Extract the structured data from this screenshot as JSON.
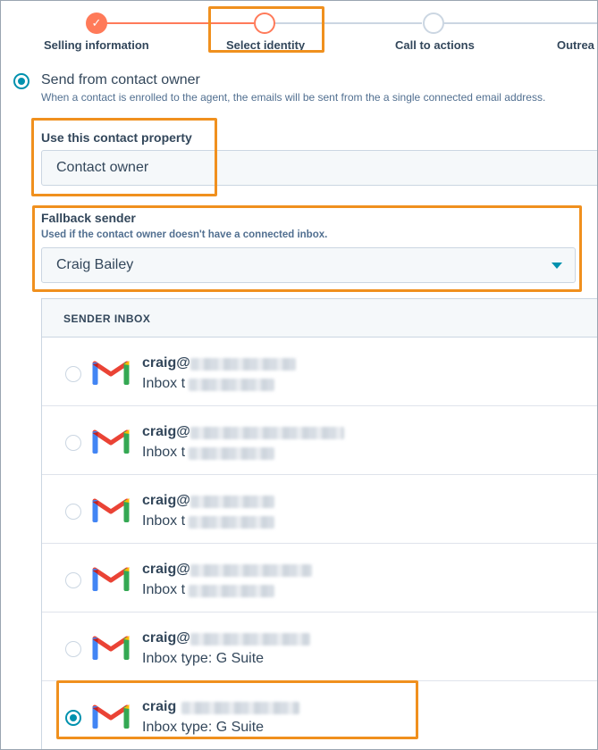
{
  "stepper": {
    "steps": [
      {
        "label": "Selling information",
        "state": "done"
      },
      {
        "label": "Select identity",
        "state": "current"
      },
      {
        "label": "Call to actions",
        "state": "upcoming"
      },
      {
        "label": "Outrea",
        "state": "upcoming"
      }
    ],
    "done_mark": "✓",
    "accent": "#ff7a59"
  },
  "send_option": {
    "title": "Send from contact owner",
    "description": "When a contact is enrolled to the agent, the emails will be sent from the a single connected email address.",
    "selected": true
  },
  "contact_property": {
    "label": "Use this contact property",
    "value": "Contact owner"
  },
  "fallback_sender": {
    "label": "Fallback sender",
    "help": "Used if the contact owner doesn't have a connected inbox.",
    "value": "Craig Bailey"
  },
  "sender_inbox": {
    "header": "SENDER INBOX",
    "rows": [
      {
        "email": "craig@",
        "inbox_type": "Inbox t",
        "selected": false,
        "icon": "gmail-icon"
      },
      {
        "email": "craig@",
        "inbox_type": "Inbox t",
        "selected": false,
        "icon": "gmail-icon"
      },
      {
        "email": "craig@",
        "inbox_type": "Inbox t",
        "selected": false,
        "icon": "gmail-icon"
      },
      {
        "email": "craig@",
        "inbox_type": "Inbox t",
        "selected": false,
        "icon": "gmail-icon"
      },
      {
        "email": "craig@",
        "inbox_type": "Inbox type: G Suite",
        "selected": false,
        "icon": "gmail-icon"
      },
      {
        "email": "craig",
        "inbox_type": "Inbox type: G Suite",
        "selected": true,
        "icon": "gmail-icon"
      }
    ]
  },
  "colors": {
    "highlight": "#f0901e",
    "radio_selected": "#0091ae",
    "text": "#33475b"
  }
}
